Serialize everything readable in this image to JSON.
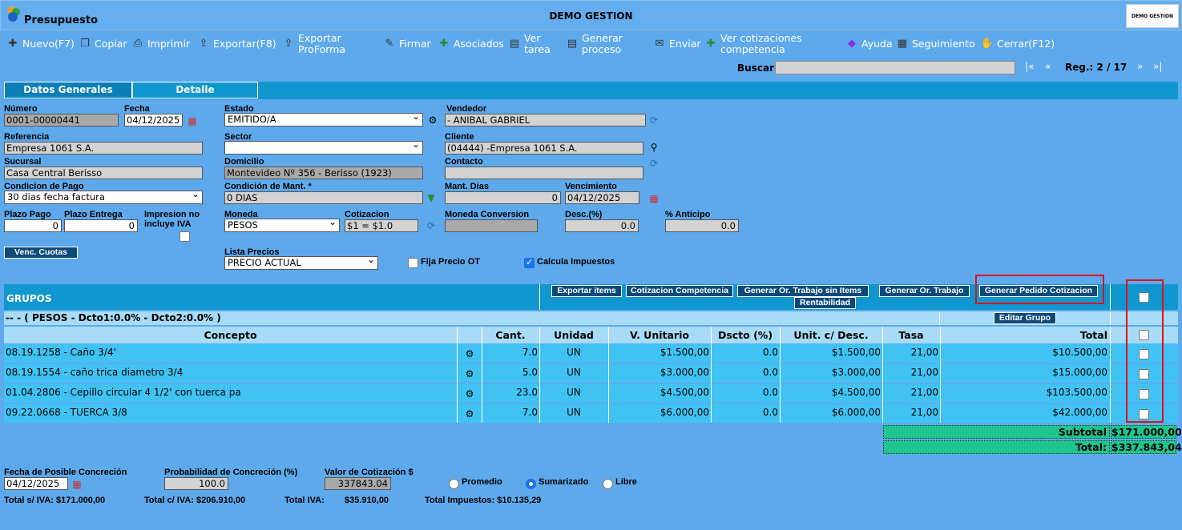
{
  "app": {
    "title": "Presupuesto",
    "center_title": "DEMO GESTION",
    "brand": "DEMO GESTION"
  },
  "toolbar": {
    "items": [
      {
        "label": "Nuevo(F7)",
        "icon": "new-icon"
      },
      {
        "label": "Copiar",
        "icon": "copy-icon"
      },
      {
        "label": "Imprimir",
        "icon": "print-icon"
      },
      {
        "label": "Exportar(F8)",
        "icon": "export-icon"
      },
      {
        "label": "Exportar ProForma",
        "icon": "export-proforma-icon"
      },
      {
        "label": "Firmar",
        "icon": "sign-icon"
      },
      {
        "label": "Asociados",
        "icon": "associates-icon"
      },
      {
        "label": "Ver tarea",
        "icon": "task-icon"
      },
      {
        "label": "Generar proceso",
        "icon": "process-icon"
      },
      {
        "label": "Enviar",
        "icon": "send-icon"
      },
      {
        "label": "Ver cotizaciones competencia",
        "icon": "quotes-icon"
      },
      {
        "label": "Ayuda",
        "icon": "help-icon"
      },
      {
        "label": "Seguimiento",
        "icon": "tracking-icon"
      },
      {
        "label": "Cerrar(F12)",
        "icon": "close-icon"
      }
    ]
  },
  "search": {
    "label": "Buscar",
    "value": "",
    "first": "|«",
    "prev": "«",
    "next": "»",
    "last": "»|",
    "record": "Reg.: 2 / 17"
  },
  "tabs": [
    {
      "label": "Datos Generales",
      "active": true
    },
    {
      "label": "Detalle",
      "active": false
    }
  ],
  "form": {
    "numero": {
      "label": "Número",
      "value": "0001-00000441"
    },
    "fecha": {
      "label": "Fecha",
      "value": "04/12/2025"
    },
    "estado": {
      "label": "Estado",
      "value": "EMITIDO/A"
    },
    "vendedor": {
      "label": "Vendedor",
      "value": "- ANIBAL GABRIEL"
    },
    "referencia": {
      "label": "Referencia",
      "value": "Empresa 1061 S.A."
    },
    "sector": {
      "label": "Sector",
      "value": ""
    },
    "cliente": {
      "label": "Cliente",
      "value": "(04444) -Empresa 1061 S.A."
    },
    "sucursal": {
      "label": "Sucursal",
      "value": "Casa Central Berisso"
    },
    "domicilio": {
      "label": "Domicilio",
      "value": "Montevideo Nº 356 - Berisso (1923)"
    },
    "contacto": {
      "label": "Contacto",
      "value": ""
    },
    "condicion_pago": {
      "label": "Condicion de Pago",
      "value": "30 dias fecha factura"
    },
    "condicion_mant": {
      "label": "Condición de Mant. *",
      "value": "0 DIAS"
    },
    "mant_dias": {
      "label": "Mant. Dias",
      "value": "0"
    },
    "vencimiento": {
      "label": "Vencimiento",
      "value": "04/12/2025"
    },
    "plazo_pago": {
      "label": "Plazo Pago",
      "value": "0"
    },
    "plazo_entrega": {
      "label": "Plazo Entrega",
      "value": "0"
    },
    "impresion": {
      "label": "Impresion no incluye IVA",
      "checked": false
    },
    "moneda": {
      "label": "Moneda",
      "value": "PESOS"
    },
    "cotizacion": {
      "label": "Cotizacion",
      "value": "$1 = $1.0"
    },
    "moneda_conv": {
      "label": "Moneda Conversion",
      "value": ""
    },
    "desc": {
      "label": "Desc.(%)",
      "value": "0.0"
    },
    "anticipo": {
      "label": "% Anticipo",
      "value": "0.0"
    },
    "venc_cuotas": "Venc. Cuotas",
    "lista_precios": {
      "label": "Lista Precios",
      "value": "PRECIO ACTUAL"
    },
    "fija_precio": {
      "label": "Fija Precio OT",
      "checked": false
    },
    "calcula_imp": {
      "label": "Calcula Impuestos",
      "checked": true
    }
  },
  "grupos": {
    "title": "GRUPOS",
    "buttons": [
      "Exportar items",
      "Cotizacion Competencia",
      "Generar Or. Trabajo sin Items",
      "Generar Or. Trabajo",
      "Generar Pedido Cotizacion",
      "Rentabilidad"
    ],
    "group_title": "-- - ( PESOS - Dcto1:0.0% - Dcto2:0.0% )",
    "edit_group": "Editar Grupo",
    "columns": [
      "Concepto",
      "Cant.",
      "Unidad",
      "V. Unitario",
      "Dscto (%)",
      "Unit. c/ Desc.",
      "Tasa",
      "Total"
    ],
    "rows": [
      {
        "concepto": "08.19.1258 - Caño 3/4'",
        "cant": "7.0",
        "unidad": "UN",
        "unitario": "$1.500,00",
        "dscto": "0.0",
        "unit_desc": "$1.500,00",
        "tasa": "21,00",
        "total": "$10.500,00"
      },
      {
        "concepto": "08.19.1554 - caño trica diametro 3/4",
        "cant": "5.0",
        "unidad": "UN",
        "unitario": "$3.000,00",
        "dscto": "0.0",
        "unit_desc": "$3.000,00",
        "tasa": "21,00",
        "total": "$15.000,00"
      },
      {
        "concepto": "01.04.2806 - Cepillo circular 4 1/2' con tuerca pa",
        "cant": "23.0",
        "unidad": "UN",
        "unitario": "$4.500,00",
        "dscto": "0.0",
        "unit_desc": "$4.500,00",
        "tasa": "21,00",
        "total": "$103.500,00"
      },
      {
        "concepto": "09.22.0668 - TUERCA 3/8",
        "cant": "7.0",
        "unidad": "UN",
        "unitario": "$6.000,00",
        "dscto": "0.0",
        "unit_desc": "$6.000,00",
        "tasa": "21,00",
        "total": "$42.000,00"
      }
    ],
    "subtotal_label": "Subtotal",
    "subtotal": "$171.000,00",
    "total_label": "Total:",
    "total": "$337.843,04"
  },
  "footer": {
    "fecha_concrecion": {
      "label": "Fecha de Posible Concreción",
      "value": "04/12/2025"
    },
    "probabilidad": {
      "label": "Probabilidad de Concreción (%)",
      "value": "100.0"
    },
    "valor_cotizacion": {
      "label": "Valor de Cotización $",
      "value": "337843.04"
    },
    "radios": [
      {
        "label": "Promedio",
        "checked": false
      },
      {
        "label": "Sumarizado",
        "checked": true
      },
      {
        "label": "Libre",
        "checked": false
      }
    ],
    "total_s_iva": "Total s/ IVA: $171.000,00",
    "total_c_iva": "Total c/ IVA: $206.910,00",
    "total_iva_label": "Total IVA:",
    "total_iva": "$35.910,00",
    "total_impuestos": "Total Impuestos: $10.135,29"
  }
}
